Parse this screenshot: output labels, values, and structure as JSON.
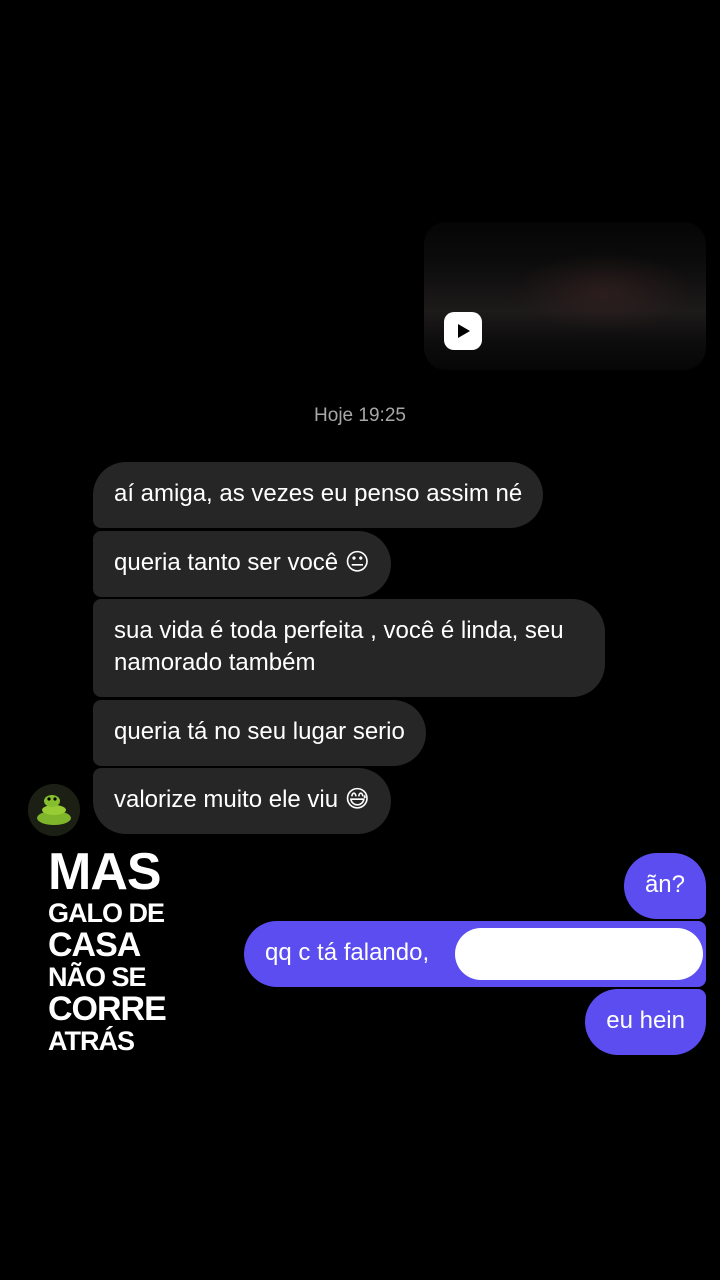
{
  "media": {
    "thumbnail_icon": "play-icon"
  },
  "timestamp": "Hoje 19:25",
  "incoming": [
    "aí amiga, as vezes eu penso assim né",
    "queria tanto ser você 😐",
    "sua vida é toda perfeita , você é linda, seu namorado também",
    "queria tá no seu lugar serio",
    "valorize muito ele viu 😅"
  ],
  "outgoing": [
    "ãn?",
    "qq c tá falando,",
    "eu hein"
  ],
  "sticker": {
    "lines": [
      "MAS",
      "GALO DE",
      "CASA",
      "NÃO SE",
      "CORRE",
      "ATRÁS"
    ]
  },
  "colors": {
    "background": "#000000",
    "incoming_bubble": "#262626",
    "outgoing_bubble": "#5b4df0",
    "timestamp": "#a7a7a7"
  }
}
